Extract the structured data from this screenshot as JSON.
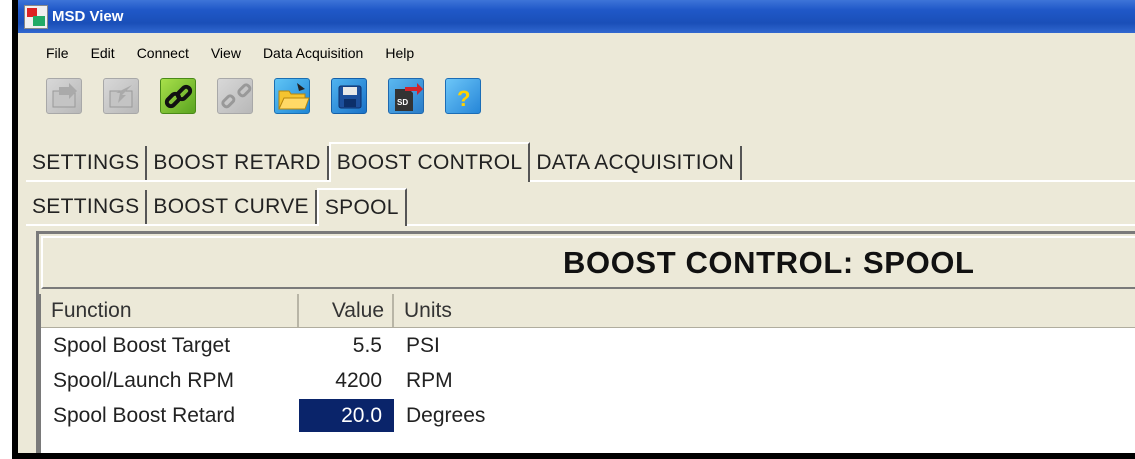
{
  "window": {
    "title": "MSD View"
  },
  "menu": [
    "File",
    "Edit",
    "Connect",
    "View",
    "Data Acquisition",
    "Help"
  ],
  "toolbar": {
    "buttons": [
      {
        "icon": "read-from-device-icon",
        "enabled": false
      },
      {
        "icon": "write-to-device-icon",
        "enabled": false
      },
      {
        "icon": "connect-link-icon",
        "enabled": true
      },
      {
        "icon": "disconnect-link-icon",
        "enabled": false
      },
      {
        "icon": "open-folder-icon",
        "enabled": true
      },
      {
        "icon": "save-disk-icon",
        "enabled": true
      },
      {
        "icon": "sd-card-transfer-icon",
        "enabled": true,
        "label": "SD"
      },
      {
        "icon": "help-icon",
        "enabled": true,
        "label": "?"
      }
    ]
  },
  "main_tabs": [
    {
      "label": "SETTINGS",
      "active": false
    },
    {
      "label": "BOOST RETARD",
      "active": false
    },
    {
      "label": "BOOST CONTROL",
      "active": true
    },
    {
      "label": "DATA ACQUISITION",
      "active": false
    }
  ],
  "sub_tabs": [
    {
      "label": "SETTINGS",
      "active": false
    },
    {
      "label": "BOOST CURVE",
      "active": false
    },
    {
      "label": "SPOOL",
      "active": true
    }
  ],
  "panel": {
    "title": "BOOST CONTROL:  SPOOL",
    "columns": {
      "function": "Function",
      "value": "Value",
      "units": "Units"
    },
    "rows": [
      {
        "function": "Spool Boost Target",
        "value": "5.5",
        "units": "PSI"
      },
      {
        "function": "Spool/Launch RPM",
        "value": "4200",
        "units": "RPM"
      },
      {
        "function": "Spool Boost Retard",
        "value": "20.0",
        "units": "Degrees",
        "selected": true
      }
    ]
  },
  "colors": {
    "titlebar": "#2058c8",
    "window_bg": "#ece9d8",
    "selection": "#0a246a"
  }
}
